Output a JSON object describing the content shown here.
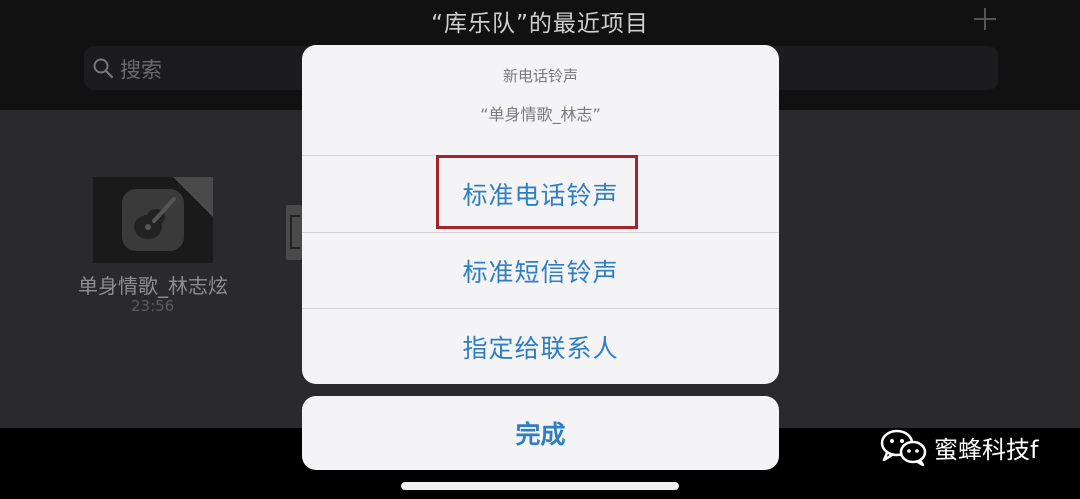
{
  "header": {
    "title": "“库乐队”的最近项目",
    "add_icon": "plus-icon"
  },
  "search": {
    "placeholder": "搜索",
    "icon": "search-icon"
  },
  "files": [
    {
      "name": "单身情歌_林志炫",
      "time": "23:56",
      "icon": "guitar-icon"
    }
  ],
  "sheet": {
    "title": "新电话铃声",
    "message": "“单身情歌_林志”",
    "options": [
      {
        "label": "标准电话铃声",
        "highlighted": true
      },
      {
        "label": "标准短信铃声"
      },
      {
        "label": "指定给联系人"
      }
    ],
    "done_label": "完成",
    "highlight_color": "#a3252b",
    "accent_color": "#2f7ec4"
  },
  "watermark": {
    "text": "蜜蜂科技f",
    "icon": "wechat-icon"
  }
}
